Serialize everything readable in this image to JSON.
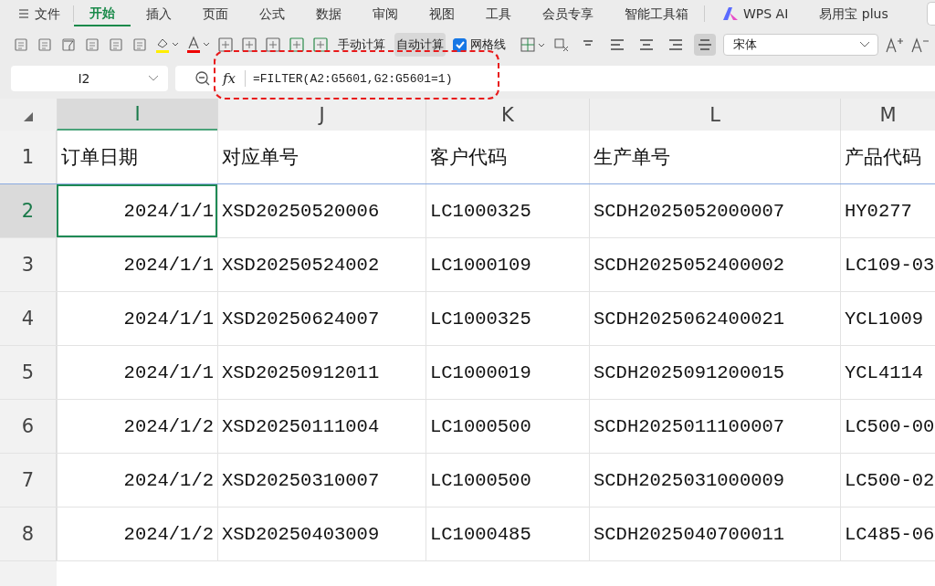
{
  "ribbon_tabs": [
    {
      "label": "文件",
      "kind": "menu",
      "selected": false
    },
    {
      "label": "开始",
      "kind": "tab",
      "selected": true
    },
    {
      "label": "插入",
      "kind": "tab",
      "selected": false
    },
    {
      "label": "页面",
      "kind": "tab",
      "selected": false
    },
    {
      "label": "公式",
      "kind": "tab",
      "selected": false
    },
    {
      "label": "数据",
      "kind": "tab",
      "selected": false
    },
    {
      "label": "审阅",
      "kind": "tab",
      "selected": false
    },
    {
      "label": "视图",
      "kind": "tab",
      "selected": false
    },
    {
      "label": "工具",
      "kind": "tab",
      "selected": false
    },
    {
      "label": "会员专享",
      "kind": "tab",
      "selected": false
    },
    {
      "label": "智能工具箱",
      "kind": "tab",
      "selected": false
    },
    {
      "label": "WPS AI",
      "kind": "ai",
      "selected": false
    },
    {
      "label": "易用宝 plus",
      "kind": "tab",
      "selected": false
    }
  ],
  "toolbar": {
    "manual_calc": {
      "label": "手动计算",
      "selected": false
    },
    "auto_calc": {
      "label": "自动计算",
      "selected": true
    },
    "gridlines": {
      "label": "网格线",
      "checked": true
    },
    "font": "宋体",
    "align_buttons": [
      {
        "selected": false
      },
      {
        "selected": false
      },
      {
        "selected": false
      },
      {
        "selected": false
      },
      {
        "selected": true
      }
    ]
  },
  "formula_bar": {
    "name_box": "I2",
    "fx": "fx",
    "formula": "=FILTER(A2:G5601,G2:G5601=1)"
  },
  "sheet": {
    "columns": [
      {
        "label": "I",
        "kind": "date",
        "selected": true
      },
      {
        "label": "J",
        "kind": "text",
        "selected": false
      },
      {
        "label": "K",
        "kind": "text",
        "selected": false
      },
      {
        "label": "L",
        "kind": "text",
        "selected": false
      },
      {
        "label": "M",
        "kind": "text",
        "selected": false
      }
    ],
    "rows": [
      {
        "number": "1",
        "kind": "header",
        "selected": false,
        "cells": [
          "订单日期",
          "对应单号",
          "客户代码",
          "生产单号",
          "产品代码"
        ]
      },
      {
        "number": "2",
        "kind": "data",
        "selected": true,
        "cells": [
          "2024/1/1",
          "XSD20250520006",
          "LC1000325",
          "SCDH2025052000007",
          "HY0277"
        ]
      },
      {
        "number": "3",
        "kind": "data",
        "selected": false,
        "cells": [
          "2024/1/1",
          "XSD20250524002",
          "LC1000109",
          "SCDH2025052400002",
          "LC109-03"
        ]
      },
      {
        "number": "4",
        "kind": "data",
        "selected": false,
        "cells": [
          "2024/1/1",
          "XSD20250624007",
          "LC1000325",
          "SCDH2025062400021",
          "YCL1009"
        ]
      },
      {
        "number": "5",
        "kind": "data",
        "selected": false,
        "cells": [
          "2024/1/1",
          "XSD20250912011",
          "LC1000019",
          "SCDH2025091200015",
          "YCL4114"
        ]
      },
      {
        "number": "6",
        "kind": "data",
        "selected": false,
        "cells": [
          "2024/1/2",
          "XSD20250111004",
          "LC1000500",
          "SCDH2025011100007",
          "LC500-00"
        ]
      },
      {
        "number": "7",
        "kind": "data",
        "selected": false,
        "cells": [
          "2024/1/2",
          "XSD20250310007",
          "LC1000500",
          "SCDH2025031000009",
          "LC500-02"
        ]
      },
      {
        "number": "8",
        "kind": "data",
        "selected": false,
        "cells": [
          "2024/1/2",
          "XSD20250403009",
          "LC1000485",
          "SCDH2025040700011",
          "LC485-06"
        ]
      }
    ]
  }
}
